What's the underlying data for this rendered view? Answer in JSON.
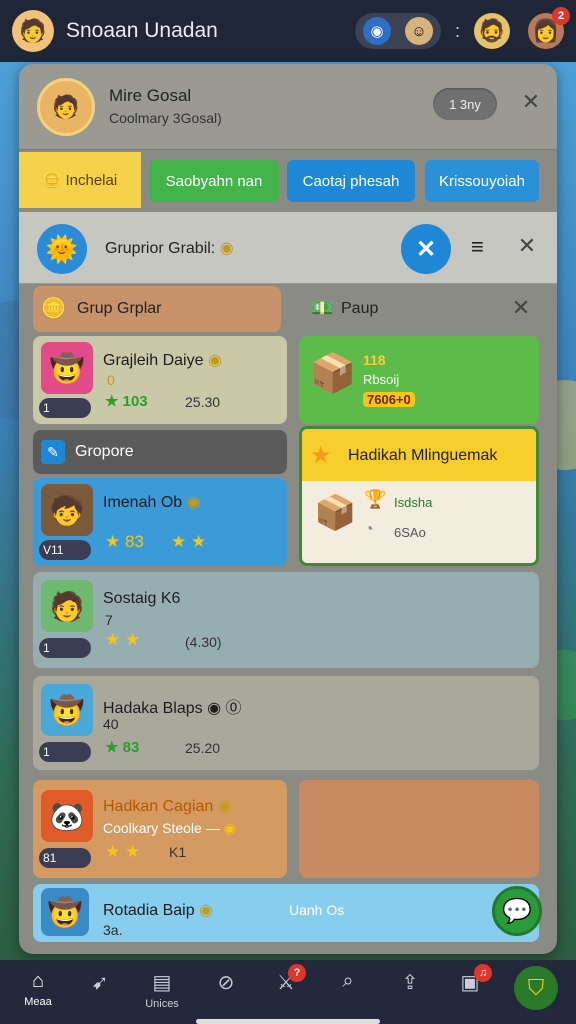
{
  "app": {
    "title": "Snoaan Unadan",
    "notif_count": "2"
  },
  "header": {
    "name": "Mire Gosal",
    "subtitle": "Coolmary 3Gosal)",
    "pill_label": "1 3ny"
  },
  "tabs": [
    {
      "label": "Inchelai"
    },
    {
      "label": "Saobyahn nan"
    },
    {
      "label": "Caotaj phesah"
    },
    {
      "label": "Krissouyoiah"
    }
  ],
  "section": {
    "title": "Gruprior Grabil:"
  },
  "group_header": {
    "label": "Grup Grplar"
  },
  "paup": {
    "label": "Paup"
  },
  "cards": [
    {
      "title": "Grajleih Daiye",
      "sub": "0",
      "chip": "1",
      "stars": "★ 103",
      "num": "25.30"
    },
    {
      "title": "Imenah Ob",
      "chip": "V11",
      "stars": "★ 83",
      "stars2": "★ ★"
    },
    {
      "title": "Sostaig K6",
      "sub": "7",
      "chip": "1",
      "stars": "★ ★",
      "num": "(4.30)"
    },
    {
      "title": "Hadaka Blaps",
      "sub": "40",
      "chip": "1",
      "stars": "★ 83",
      "num": "25.20"
    },
    {
      "title": "Hadkan Cagian",
      "sub": "Coolkary Steole —",
      "chip": "81",
      "stars": "★ ★",
      "num": "K1"
    },
    {
      "title": "Rotadia Baip",
      "sub": "3a.",
      "extra": "Uanh Os"
    }
  ],
  "reward": {
    "qty": "118",
    "desc": "Rbsoij",
    "price": "7606+0"
  },
  "groupore": {
    "label": "Gropore"
  },
  "weekly": {
    "title": "Hadikah Mlinguemak",
    "line1": "Isdsha",
    "line2": "6SAo"
  },
  "nav": {
    "home": "Meaa",
    "invites": "Unices"
  },
  "colors": {
    "accent": "#f5c518",
    "blue": "#1f88d6",
    "green": "#3cb043"
  },
  "icons": [
    "home-icon",
    "bird-icon",
    "invite-icon",
    "circle-icon",
    "swords-icon",
    "search-icon",
    "share-icon",
    "gift-icon",
    "shield-icon"
  ]
}
